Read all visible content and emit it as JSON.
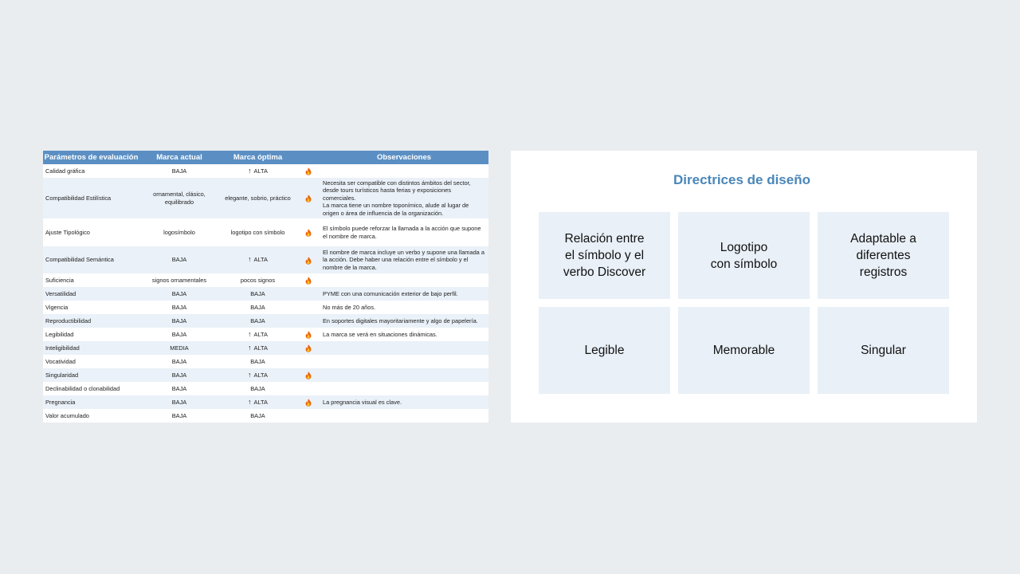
{
  "table": {
    "headers": [
      "Parámetros de evaluación",
      "Marca actual",
      "Marca óptima",
      "Observaciones"
    ],
    "rows": [
      {
        "param": "Calidad gráfica",
        "actual": "BAJA",
        "optima": "ALTA",
        "arrow": true,
        "fire": true,
        "obs": ""
      },
      {
        "param": "Compatibilidad Estilística",
        "actual": "ornamental, clásico, equilibrado",
        "optima": "elegante, sobrio, práctico",
        "arrow": false,
        "fire": true,
        "obs": "Necesita ser compatible con distintos ámbitos del sector, desde tours turísticos hasta ferias y exposiciones comerciales.\nLa marca tiene un nombre toponímico, alude al lugar de origen o área de influencia de la organización."
      },
      {
        "param": "Ajuste Tipológico",
        "actual": "logosímbolo",
        "optima": "logotipo con símbolo",
        "arrow": false,
        "fire": true,
        "obs": "El símbolo puede reforzar la llamada a la acción que supone el nombre de marca."
      },
      {
        "param": "Compatibilidad Semántica",
        "actual": "BAJA",
        "optima": "ALTA",
        "arrow": true,
        "fire": true,
        "obs": "El nombre de marca incluye un verbo y supone una llamada a la acción. Debe haber una relación entre el símbolo y el nombre de la marca."
      },
      {
        "param": "Suficiencia",
        "actual": "signos ornamentales",
        "optima": "pocos signos",
        "arrow": false,
        "fire": true,
        "obs": ""
      },
      {
        "param": "Versatilidad",
        "actual": "BAJA",
        "optima": "BAJA",
        "arrow": false,
        "fire": false,
        "obs": "PYME con una comunicación exterior de bajo perfil."
      },
      {
        "param": "Vigencia",
        "actual": "BAJA",
        "optima": "BAJA",
        "arrow": false,
        "fire": false,
        "obs": "No más de 20 años."
      },
      {
        "param": "Reproductibilidad",
        "actual": "BAJA",
        "optima": "BAJA",
        "arrow": false,
        "fire": false,
        "obs": "En soportes digitales mayoritariamente y algo de papelería."
      },
      {
        "param": "Legibilidad",
        "actual": "BAJA",
        "optima": "ALTA",
        "arrow": true,
        "fire": true,
        "obs": "La marca se verá en situaciones dinámicas."
      },
      {
        "param": "Inteligibilidad",
        "actual": "MEDIA",
        "optima": "ALTA",
        "arrow": true,
        "fire": true,
        "obs": ""
      },
      {
        "param": "Vocatividad",
        "actual": "BAJA",
        "optima": "BAJA",
        "arrow": false,
        "fire": false,
        "obs": ""
      },
      {
        "param": "Singularidad",
        "actual": "BAJA",
        "optima": "ALTA",
        "arrow": true,
        "fire": true,
        "obs": ""
      },
      {
        "param": "Declinabilidad o clonabilidad",
        "actual": "BAJA",
        "optima": "BAJA",
        "arrow": false,
        "fire": false,
        "obs": ""
      },
      {
        "param": "Pregnancia",
        "actual": "BAJA",
        "optima": "ALTA",
        "arrow": true,
        "fire": true,
        "obs": "La pregnancia visual es clave."
      },
      {
        "param": "Valor acumulado",
        "actual": "BAJA",
        "optima": "BAJA",
        "arrow": false,
        "fire": false,
        "obs": ""
      }
    ]
  },
  "panel": {
    "title": "Directrices de diseño",
    "tiles": [
      "Relación entre\nel símbolo y el\nverbo Discover",
      "Logotipo\ncon símbolo",
      "Adaptable a\ndiferentes\nregistros",
      "Legible",
      "Memorable",
      "Singular"
    ]
  },
  "colors": {
    "page_bg": "#e9edf0",
    "header_bg": "#5b8fc4",
    "row_alt": "#eaf1f8",
    "title": "#4a86b9",
    "tile_bg": "#e9f0f7"
  },
  "icons": {
    "arrow": "up-arrow-icon",
    "fire": "fire-icon"
  }
}
